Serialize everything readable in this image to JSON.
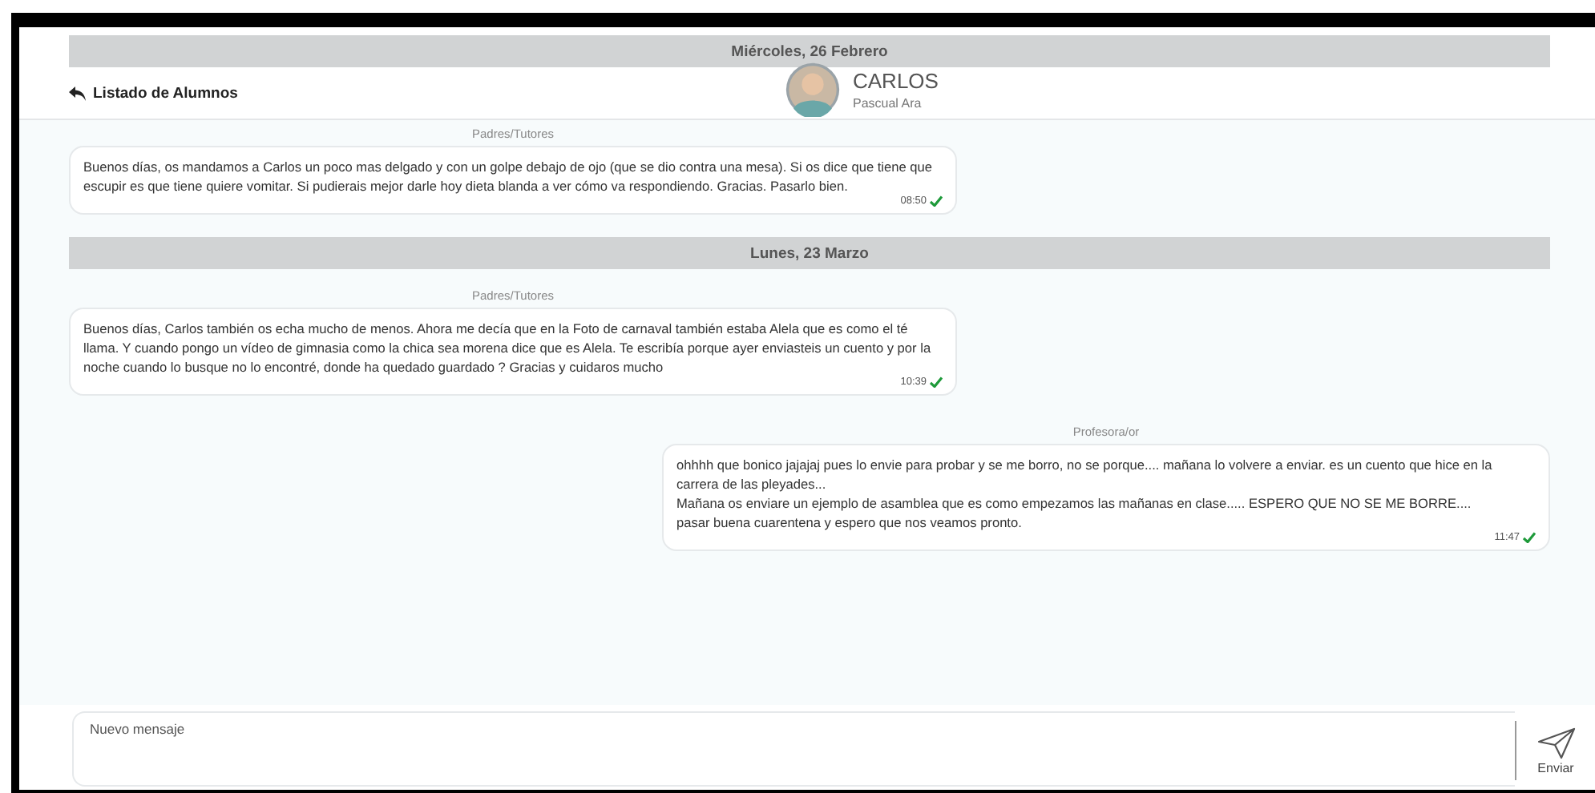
{
  "header": {
    "back_link": "Listado de Alumnos",
    "student_name": "CARLOS",
    "student_surname": "Pascual Ara"
  },
  "sticky_date": "Miércoles, 26 Febrero",
  "timeline": [
    {
      "kind": "incoming",
      "sender": "Padres/Tutores",
      "text": "Buenos días, os mandamos a Carlos un poco mas delgado y con un golpe debajo de ojo (que se dio contra una mesa). Si os dice que tiene que escupir es que tiene quiere vomitar. Si pudierais mejor darle hoy dieta blanda a ver cómo va respondiendo. Gracias. Pasarlo bien.",
      "time": "08:50",
      "read": true
    },
    {
      "kind": "date",
      "label": "Lunes, 23 Marzo"
    },
    {
      "kind": "incoming",
      "sender": "Padres/Tutores",
      "text": "Buenos días, Carlos también os echa mucho de menos. Ahora me decía que en la Foto de carnaval también estaba Alela que es como el té llama. Y cuando pongo un vídeo de gimnasia como la chica sea morena dice que es Alela. Te escribía porque ayer enviasteis un cuento y por la noche cuando lo busque no lo encontré, donde ha quedado guardado ? Gracias y cuidaros mucho",
      "time": "10:39",
      "read": true
    },
    {
      "kind": "outgoing",
      "sender": "Profesora/or",
      "text": "ohhhh que bonico jajajaj pues lo envie para probar y se me borro, no se porque.... mañana lo volvere a enviar. es un cuento que hice en la carrera de las pleyades...\nMañana os enviare un ejemplo de asamblea que es como empezamos las mañanas en clase..... ESPERO QUE NO SE ME BORRE....\npasar buena cuarentena y espero que nos veamos pronto.",
      "time": "11:47",
      "read": true
    }
  ],
  "composer": {
    "placeholder": "Nuevo mensaje",
    "send_label": "Enviar"
  }
}
